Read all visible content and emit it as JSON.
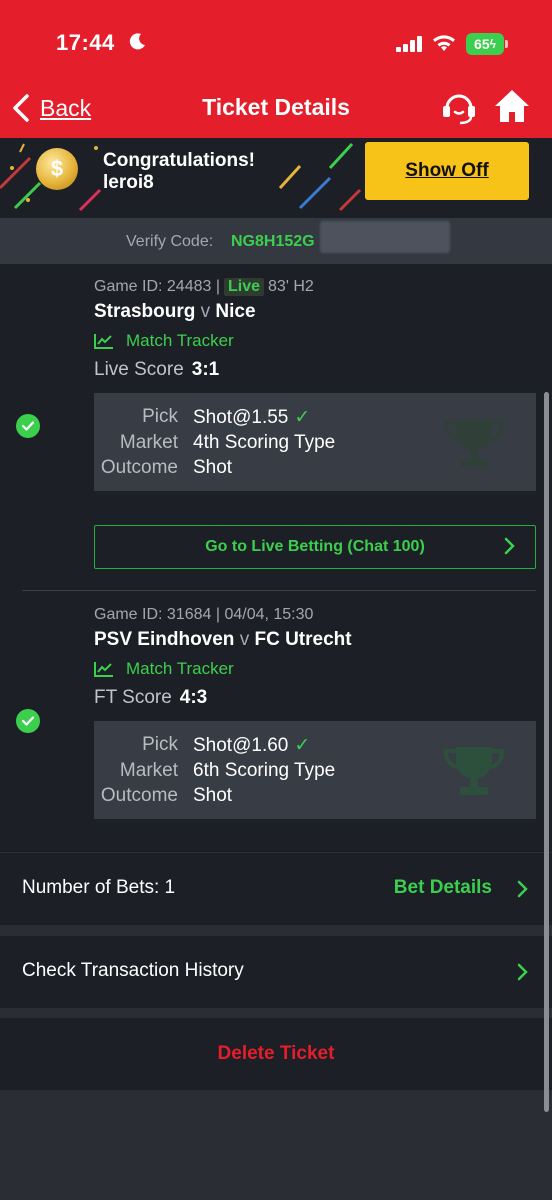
{
  "status_bar": {
    "time": "17:44",
    "battery": "65"
  },
  "header": {
    "back_label": "Back",
    "title": "Ticket Details"
  },
  "banner": {
    "congrats": "Congratulations!",
    "username": "leroi8",
    "show_off": "Show Off"
  },
  "verify": {
    "label": "Verify Code:",
    "code": "NG8H152G"
  },
  "bets": [
    {
      "game_id": "Game ID: 24483 |",
      "live": "Live",
      "time_info": "83' H2",
      "home": "Strasbourg",
      "v": "v",
      "away": "Nice",
      "tracker": "Match Tracker",
      "score_label": "Live Score",
      "score": "3:1",
      "pick_label": "Pick",
      "pick": "Shot@1.55",
      "market_label": "Market",
      "market": "4th Scoring Type",
      "outcome_label": "Outcome",
      "outcome": "Shot"
    },
    {
      "game_id": "Game ID: 31684 | 04/04, 15:30",
      "home": "PSV Eindhoven",
      "v": "v",
      "away": "FC Utrecht",
      "tracker": "Match Tracker",
      "score_label": "FT Score",
      "score": "4:3",
      "pick_label": "Pick",
      "pick": "Shot@1.60",
      "market_label": "Market",
      "market": "6th Scoring Type",
      "outcome_label": "Outcome",
      "outcome": "Shot"
    }
  ],
  "live_betting_button": "Go to Live Betting (Chat 100)",
  "summary": {
    "number_of_bets": "Number of Bets: 1",
    "bet_details": "Bet Details"
  },
  "transaction_history": "Check Transaction History",
  "delete_ticket": "Delete Ticket",
  "colors": {
    "header_red": "#e41e2b",
    "accent_green": "#3ccf4e",
    "show_off_yellow": "#f7c319",
    "card_bg": "#1c1f25"
  },
  "icons": [
    "moon-icon",
    "signal-icon",
    "wifi-icon",
    "battery-icon",
    "back-chevron-icon",
    "support-headset-icon",
    "home-icon",
    "coin-icon",
    "check-icon",
    "chart-icon",
    "trophy-icon",
    "chevron-right-icon"
  ]
}
